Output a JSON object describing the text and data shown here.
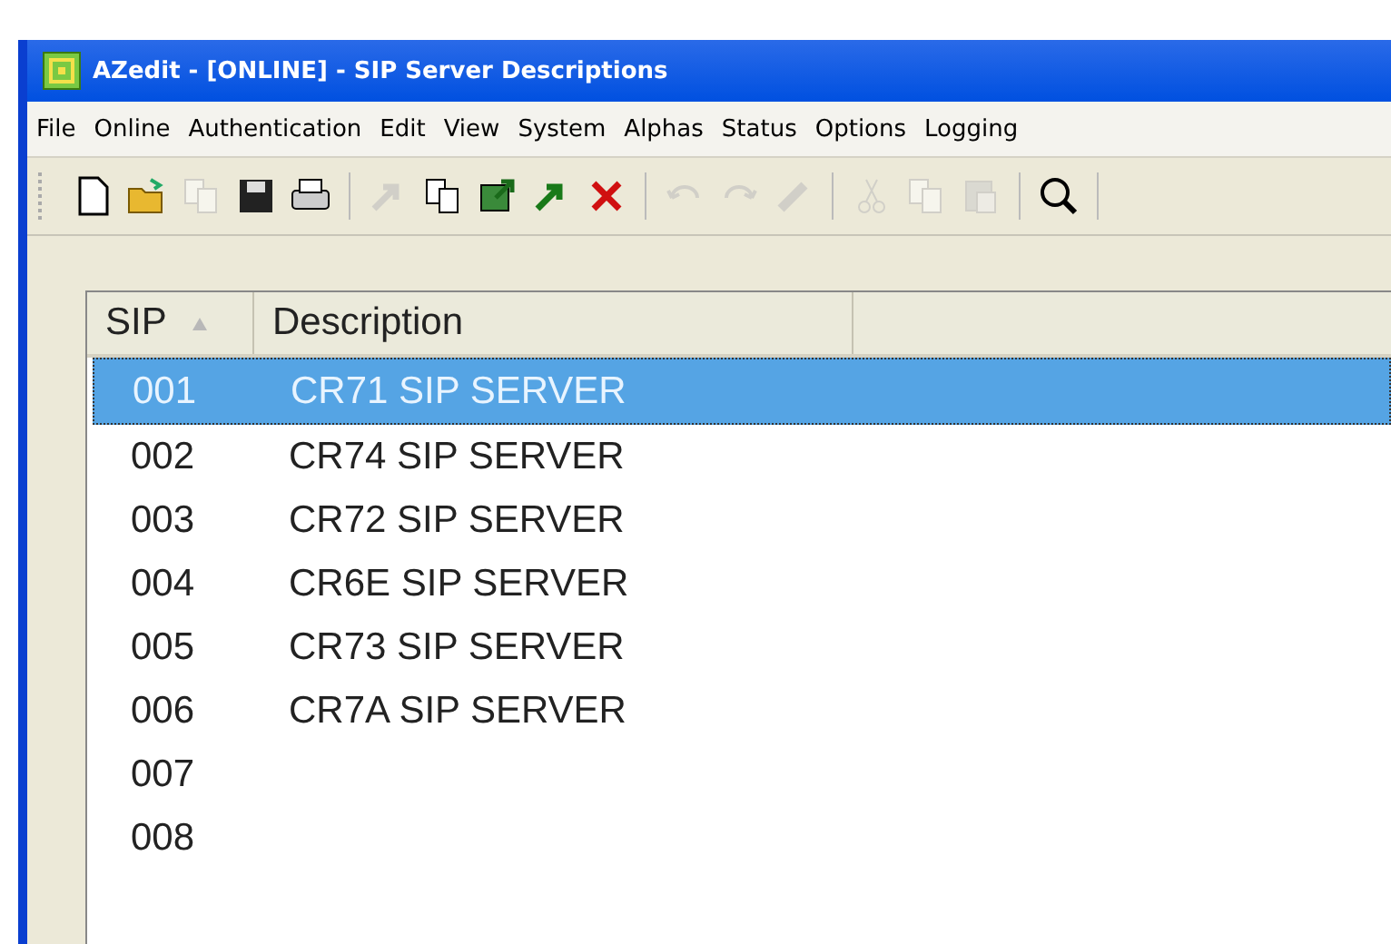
{
  "window": {
    "title": "AZedit - [ONLINE] - SIP Server Descriptions"
  },
  "menu": [
    "File",
    "Online",
    "Authentication",
    "Edit",
    "View",
    "System",
    "Alphas",
    "Status",
    "Options",
    "Logging"
  ],
  "toolbar": [
    {
      "kind": "new",
      "disabled": false
    },
    {
      "kind": "open",
      "disabled": false
    },
    {
      "kind": "copy",
      "disabled": true
    },
    {
      "kind": "save",
      "disabled": false
    },
    {
      "kind": "print",
      "disabled": false
    },
    {
      "kind": "sep"
    },
    {
      "kind": "arrow",
      "disabled": true
    },
    {
      "kind": "copy",
      "disabled": false
    },
    {
      "kind": "export",
      "disabled": false
    },
    {
      "kind": "arrow",
      "disabled": false
    },
    {
      "kind": "delete",
      "disabled": false
    },
    {
      "kind": "sep"
    },
    {
      "kind": "undo",
      "disabled": true
    },
    {
      "kind": "redo",
      "disabled": true
    },
    {
      "kind": "pencil",
      "disabled": true
    },
    {
      "kind": "sep"
    },
    {
      "kind": "cut",
      "disabled": true
    },
    {
      "kind": "copy",
      "disabled": true
    },
    {
      "kind": "paste",
      "disabled": true
    },
    {
      "kind": "sep"
    },
    {
      "kind": "search",
      "disabled": false
    },
    {
      "kind": "sep"
    }
  ],
  "table": {
    "columns": [
      "SIP",
      "Description"
    ],
    "rows": [
      {
        "sip": "001",
        "description": "CR71 SIP SERVER",
        "selected": true
      },
      {
        "sip": "002",
        "description": "CR74 SIP SERVER",
        "selected": false
      },
      {
        "sip": "003",
        "description": "CR72 SIP SERVER",
        "selected": false
      },
      {
        "sip": "004",
        "description": "CR6E SIP SERVER",
        "selected": false
      },
      {
        "sip": "005",
        "description": "CR73 SIP SERVER",
        "selected": false
      },
      {
        "sip": "006",
        "description": "CR7A SIP SERVER",
        "selected": false
      },
      {
        "sip": "007",
        "selected": false
      },
      {
        "sip": "008",
        "selected": false
      }
    ]
  }
}
